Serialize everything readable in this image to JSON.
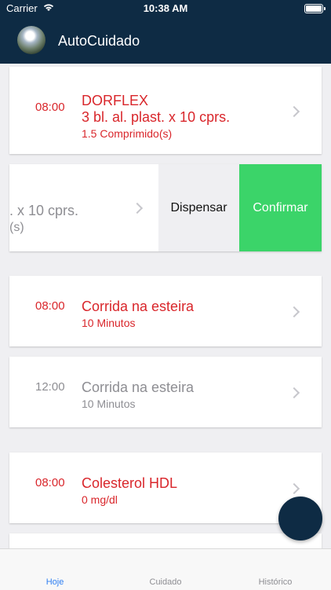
{
  "status_bar": {
    "carrier": "Carrier",
    "time": "10:38 AM"
  },
  "nav": {
    "title": "AutoCuidado"
  },
  "cards": [
    {
      "time": "08:00",
      "name": "DORFLEX",
      "line2": "3 bl. al. plast. x 10 cprs.",
      "detail": "1.5 Comprimido(s)"
    },
    {
      "name_partial": ". x 10 cprs.",
      "detail_partial": "(s)"
    },
    {
      "time": "08:00",
      "name": "Corrida na esteira",
      "detail": "10 Minutos"
    },
    {
      "time": "12:00",
      "name": "Corrida na esteira",
      "detail": "10 Minutos"
    },
    {
      "time": "08:00",
      "name": "Colesterol HDL",
      "detail": "0 mg/dl"
    }
  ],
  "swipe_actions": {
    "dispensar": "Dispensar",
    "confirmar": "Confirmar"
  },
  "tabs": [
    {
      "label": "Hoje",
      "active": true
    },
    {
      "label": "Cuidado",
      "active": false
    },
    {
      "label": "Histórico",
      "active": false
    }
  ],
  "colors": {
    "nav": "#0e2b44",
    "accent_red": "#d9262b",
    "confirm_green": "#3bd469",
    "tab_active": "#2f7ff2"
  },
  "icons": {
    "status": [
      "wifi-icon",
      "battery-icon"
    ],
    "chevron": "chevron-right-icon"
  }
}
